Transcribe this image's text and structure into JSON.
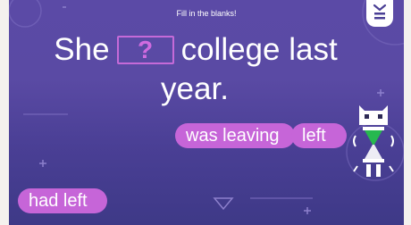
{
  "instruction": "Fill in the blanks!",
  "sentence": {
    "before_blank": "She",
    "blank_mark": "?",
    "after_blank": "college last",
    "line2": "year."
  },
  "options": [
    {
      "label": "was leaving"
    },
    {
      "label": "left"
    },
    {
      "label": "had left"
    }
  ],
  "icons": {
    "menu": "menu-icon",
    "mascot": "robot-hourglass-mascot"
  },
  "colors": {
    "background": "#5a4aa4",
    "option_chip": "#c665d8",
    "blank_border": "#c56ad8"
  }
}
